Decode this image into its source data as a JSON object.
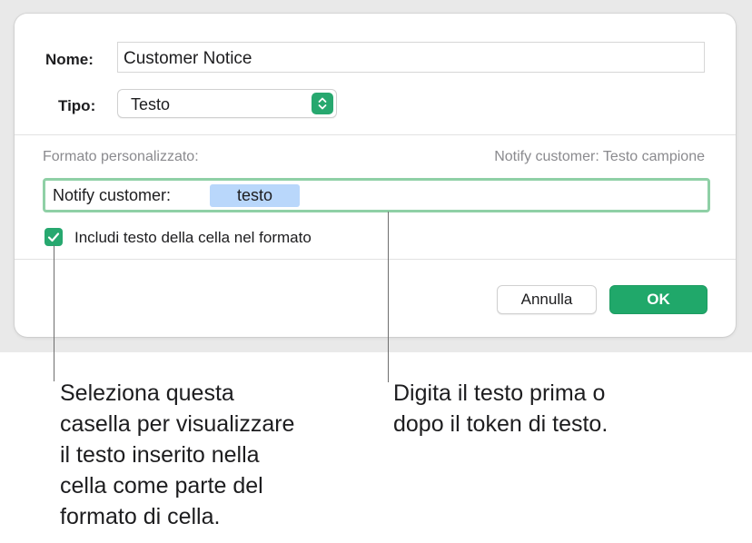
{
  "dialog": {
    "name_label": "Nome:",
    "name_value": "Customer Notice",
    "type_label": "Tipo:",
    "type_value": "Testo",
    "custom_format_label": "Formato personalizzato:",
    "sample_text": "Notify customer: Testo campione",
    "format_prefix": "Notify customer:",
    "format_token": "testo",
    "include_checkbox": {
      "checked": true,
      "label": "Includi testo della cella nel formato"
    },
    "cancel_label": "Annulla",
    "ok_label": "OK"
  },
  "callouts": {
    "checkbox_note": [
      "Seleziona questa",
      "casella per visualizzare",
      "il testo inserito nella",
      "cella come parte del",
      "formato di cella."
    ],
    "token_note": [
      "Digita il testo prima o",
      "dopo il token di testo."
    ]
  },
  "colors": {
    "accent_green": "#20a86a",
    "focus_ring": "#8fd0a6",
    "token_blue": "#b9d7fb"
  },
  "icons": {
    "select_stepper": "chevron-up-down-icon",
    "checkbox": "checkmark-icon"
  }
}
